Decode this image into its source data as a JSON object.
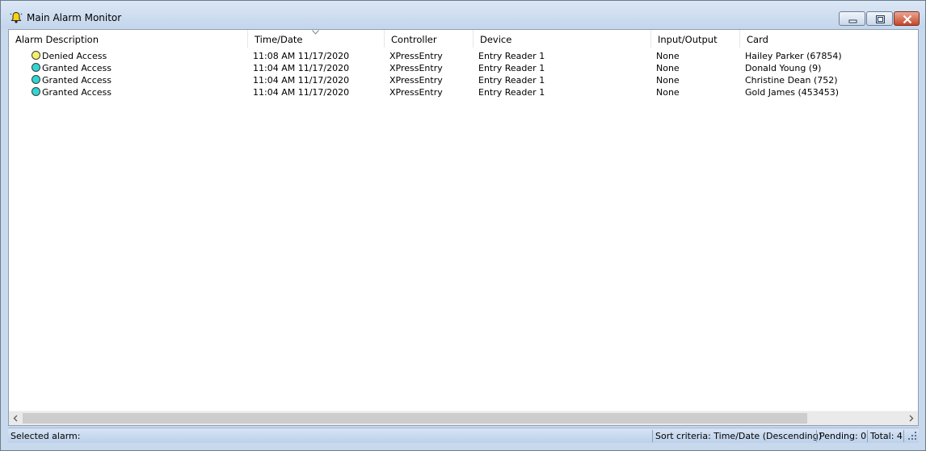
{
  "window": {
    "title": "Main Alarm Monitor",
    "icon": "bell-icon"
  },
  "columns": [
    "Alarm Description",
    "Time/Date",
    "Controller",
    "Device",
    "Input/Output",
    "Card"
  ],
  "sort_indicator": "sort-descending-icon",
  "rows": [
    {
      "status": "denied",
      "description": "Denied Access",
      "time": "11:08 AM  11/17/2020",
      "controller": "XPressEntry",
      "device": "Entry Reader 1",
      "io": "None",
      "card": "Hailey Parker (67854)"
    },
    {
      "status": "granted",
      "description": "Granted Access",
      "time": "11:04 AM  11/17/2020",
      "controller": "XPressEntry",
      "device": "Entry Reader 1",
      "io": "None",
      "card": "Donald Young (9)"
    },
    {
      "status": "granted",
      "description": "Granted Access",
      "time": "11:04 AM  11/17/2020",
      "controller": "XPressEntry",
      "device": "Entry Reader 1",
      "io": "None",
      "card": "Christine Dean (752)"
    },
    {
      "status": "granted",
      "description": "Granted Access",
      "time": "11:04 AM  11/17/2020",
      "controller": "XPressEntry",
      "device": "Entry Reader 1",
      "io": "None",
      "card": "Gold James (453453)"
    }
  ],
  "statusbar": {
    "selected": "Selected alarm:",
    "sort": "Sort criteria: Time/Date (Descending)",
    "pending": "Pending: 0",
    "total": "Total: 4"
  },
  "colors": {
    "denied": "#f6f06a",
    "granted": "#2fd6d3"
  }
}
